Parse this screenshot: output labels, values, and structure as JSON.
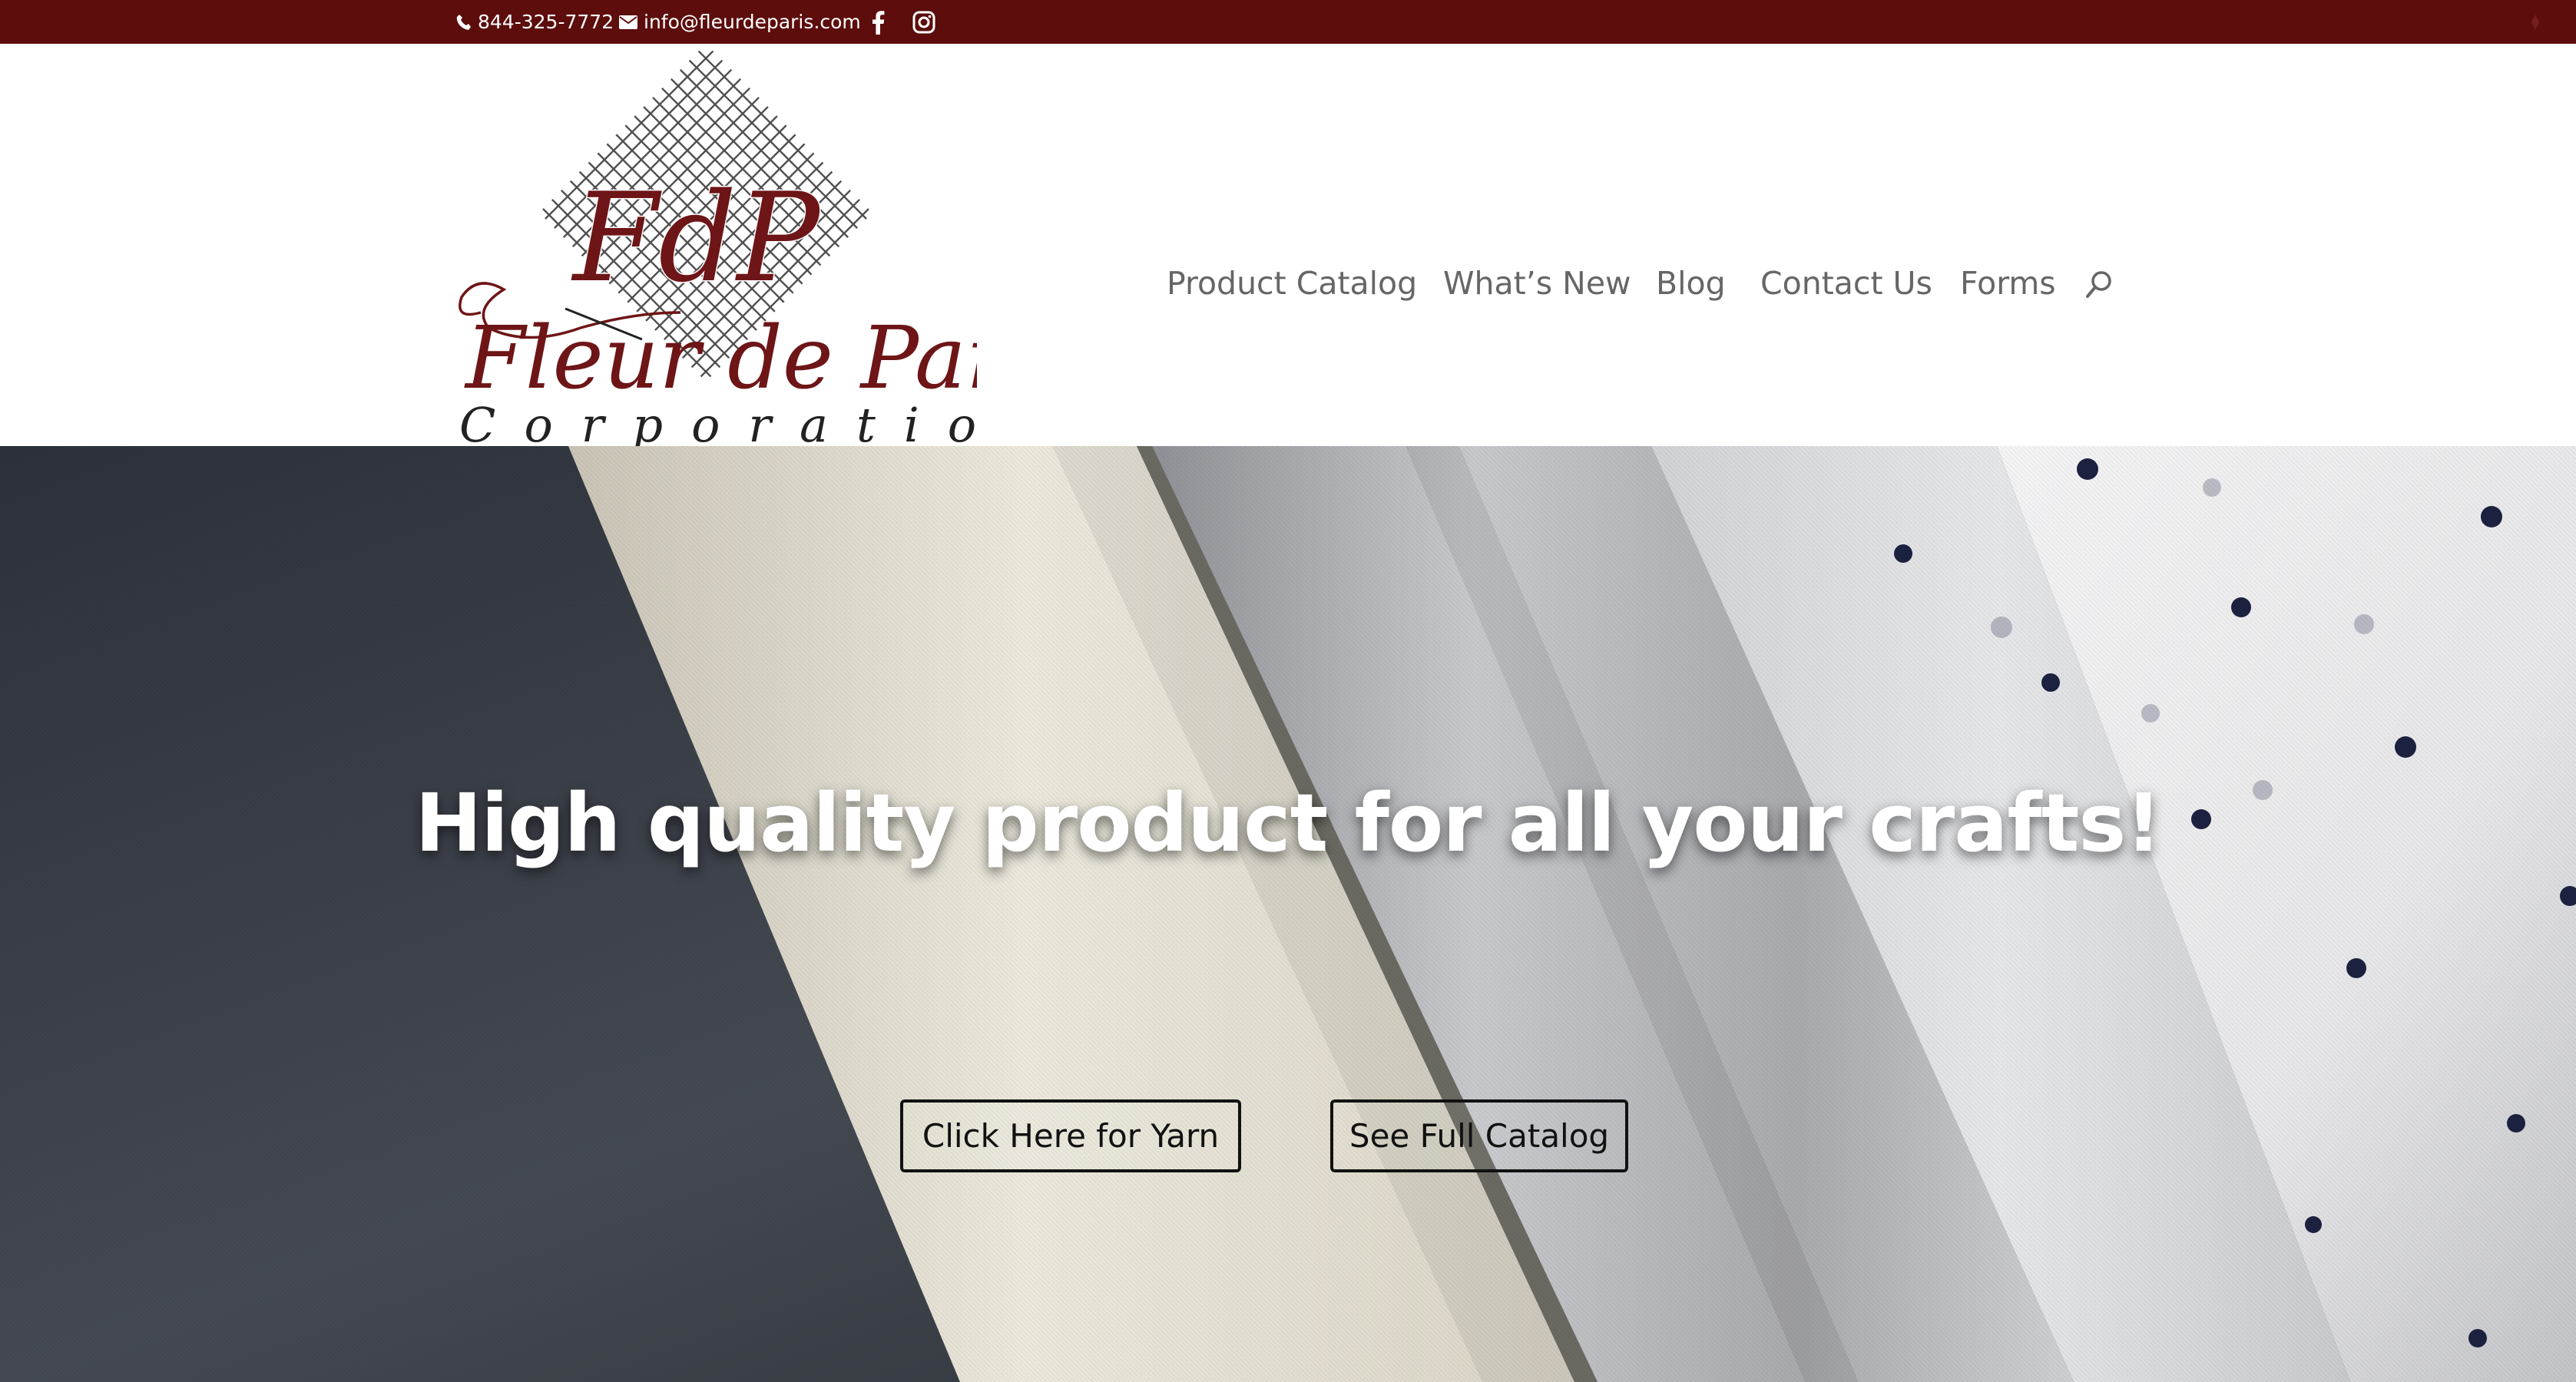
{
  "topbar": {
    "phone": "844-325-7772",
    "email": "info@fleurdeparis.com",
    "icons": [
      "phone-icon",
      "mail-icon",
      "facebook-icon",
      "instagram-icon"
    ],
    "background_color": "#5c0d0c"
  },
  "logo": {
    "monogram": "FdP",
    "name": "Fleur de Paris",
    "subtitle": "Corporation",
    "brand_color": "#6e1517"
  },
  "nav": {
    "items": [
      {
        "label": "Product Catalog"
      },
      {
        "label": "What’s New"
      },
      {
        "label": "Blog"
      },
      {
        "label": "Contact Us"
      },
      {
        "label": "Forms"
      }
    ],
    "search_icon": "search-icon"
  },
  "hero": {
    "title": "High quality product for all your crafts!",
    "buttons": [
      {
        "label": "Click Here for Yarn"
      },
      {
        "label": "See Full Catalog"
      }
    ]
  }
}
